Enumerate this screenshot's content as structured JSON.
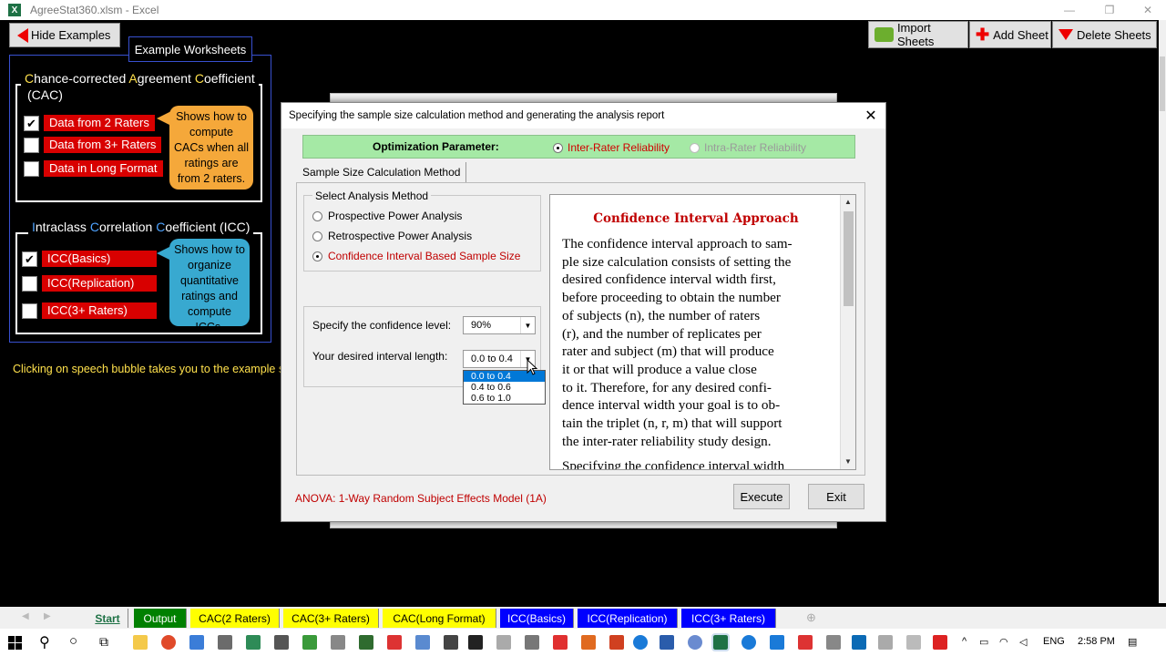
{
  "app": {
    "title": "AgreeStat360.xlsm - Excel",
    "icon_letter": "X"
  },
  "toolbar": {
    "hide_examples": "Hide Examples",
    "import_sheets": "Import Sheets",
    "add_sheet": "Add Sheet",
    "delete_sheets": "Delete Sheets"
  },
  "examples": {
    "tab_label": "Example Worksheets",
    "cac": {
      "title_line1_parts": [
        "C",
        "hance-corrected ",
        "A",
        "greement ",
        "C",
        "oefficient"
      ],
      "title_line2": "(CAC)",
      "items": [
        {
          "label": "Data from 2 Raters",
          "checked": true
        },
        {
          "label": "Data from 3+ Raters",
          "checked": false
        },
        {
          "label": "Data in Long Format",
          "checked": false
        }
      ],
      "bubble": "Shows how to compute CACs when all ratings are from 2 raters."
    },
    "icc": {
      "title_parts": [
        "I",
        "ntraclass ",
        "C",
        "orrelation ",
        "C",
        "oefficient (ICC)"
      ],
      "items": [
        {
          "label": "ICC(Basics)",
          "checked": true
        },
        {
          "label": "ICC(Replication)",
          "checked": false
        },
        {
          "label": "ICC(3+ Raters)",
          "checked": false
        }
      ],
      "bubble": "Shows how to organize quantitative ratings and compute ICCs."
    },
    "note": "Clicking on speech bubble takes you to the example s"
  },
  "dialog": {
    "title": "Specifying the sample size calculation method and generating the analysis report",
    "close": "✕",
    "optimization_label": "Optimization Parameter:",
    "opt_inter": "Inter-Rater Reliability",
    "opt_intra": "Intra-Rater Reliability",
    "tab_label": "Sample Size Calculation Method",
    "select_method_legend": "Select Analysis Method",
    "methods": [
      {
        "label": "Prospective Power Analysis",
        "selected": false
      },
      {
        "label": "Retrospective Power Analysis",
        "selected": false
      },
      {
        "label": "Confidence Interval Based Sample Size",
        "selected": true
      }
    ],
    "confidence_label": "Specify the confidence level:",
    "confidence_value": "90%",
    "interval_label": "Your desired interval length:",
    "interval_value": "0.0 to 0.4",
    "interval_options": [
      "0.0 to 0.4",
      "0.4 to 0.6",
      "0.6 to 1.0"
    ],
    "text_heading": "Confidence Interval Approach",
    "text_body": [
      "The confidence interval approach to sam-",
      "ple size calculation consists of setting the",
      "desired confidence interval width first,",
      "before proceeding to obtain the number",
      "of subjects (n), the number of raters",
      "(r), and the number of replicates per",
      "rater and subject (m) that will produce",
      "it or that will produce a value close",
      "to it.  Therefore, for any desired confi-",
      "dence interval width your goal is to ob-",
      "tain the triplet (n, r, m) that will support",
      "the inter-rater reliability study design."
    ],
    "text_more": "Specifying the confidence interval width",
    "model": "ANOVA: 1-Way Random Subject Effects Model (1A)",
    "execute": "Execute",
    "exit": "Exit"
  },
  "sheet_tabs": [
    {
      "label": "Start",
      "bg": "#ffffff",
      "fg": "#000000",
      "active": true
    },
    {
      "label": "Output",
      "bg": "#008000",
      "fg": "#ffffff"
    },
    {
      "label": "CAC(2 Raters)",
      "bg": "#ffff00",
      "fg": "#000000"
    },
    {
      "label": "CAC(3+ Raters)",
      "bg": "#ffff00",
      "fg": "#000000"
    },
    {
      "label": "CAC(Long Format)",
      "bg": "#ffff00",
      "fg": "#000000"
    },
    {
      "label": "ICC(Basics)",
      "bg": "#0000ff",
      "fg": "#ffffff"
    },
    {
      "label": "ICC(Replication)",
      "bg": "#0000ff",
      "fg": "#ffffff"
    },
    {
      "label": "ICC(3+ Raters)",
      "bg": "#0000ff",
      "fg": "#ffffff"
    }
  ],
  "tray": {
    "lang": "ENG",
    "time": "2:58 PM"
  },
  "colors": {
    "accent_red": "#d80000",
    "opt_bar": "#a5e9a5",
    "frame_blue": "#3850d0"
  }
}
